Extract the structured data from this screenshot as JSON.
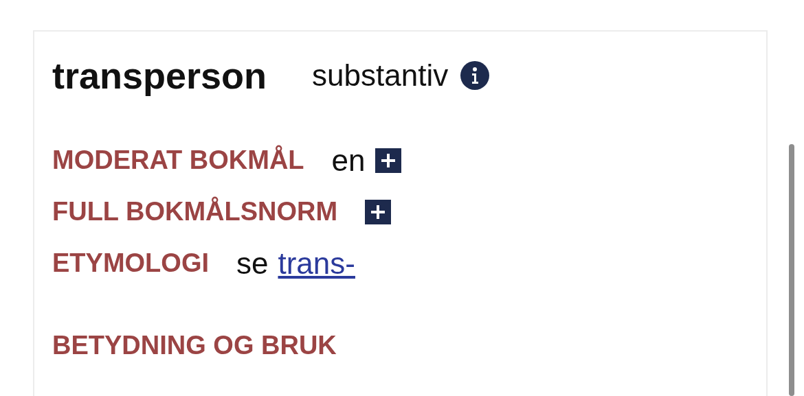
{
  "entry": {
    "headword": "transperson",
    "word_class": "substantiv"
  },
  "sections": [
    {
      "kind": "inflection",
      "heading": "MODERAT BOKMÅL",
      "value": "en",
      "expanded": false
    },
    {
      "kind": "inflection",
      "heading": "FULL BOKMÅLSNORM",
      "expanded": false
    },
    {
      "kind": "etymology",
      "heading": "ETYMOLOGI",
      "text": "se",
      "link": "trans-"
    },
    {
      "kind": "heading",
      "heading": "BETYDNING OG BRUK"
    }
  ]
}
